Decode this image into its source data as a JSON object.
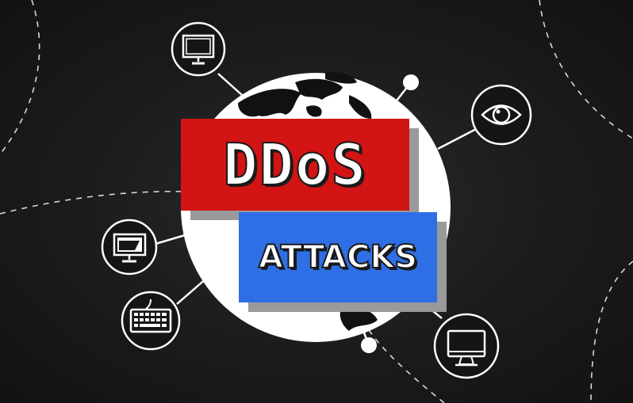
{
  "title": {
    "main": "DDoS",
    "sub": "ATTACKS"
  },
  "colors": {
    "background": "#151515",
    "red_banner": "#d21414",
    "blue_banner": "#2f6fe6",
    "globe": "#ffffff",
    "lines": "#ffffff"
  },
  "icons": [
    "monitor-icon",
    "eye-icon",
    "desktop-monitor-icon",
    "keyboard-icon",
    "imac-icon"
  ]
}
